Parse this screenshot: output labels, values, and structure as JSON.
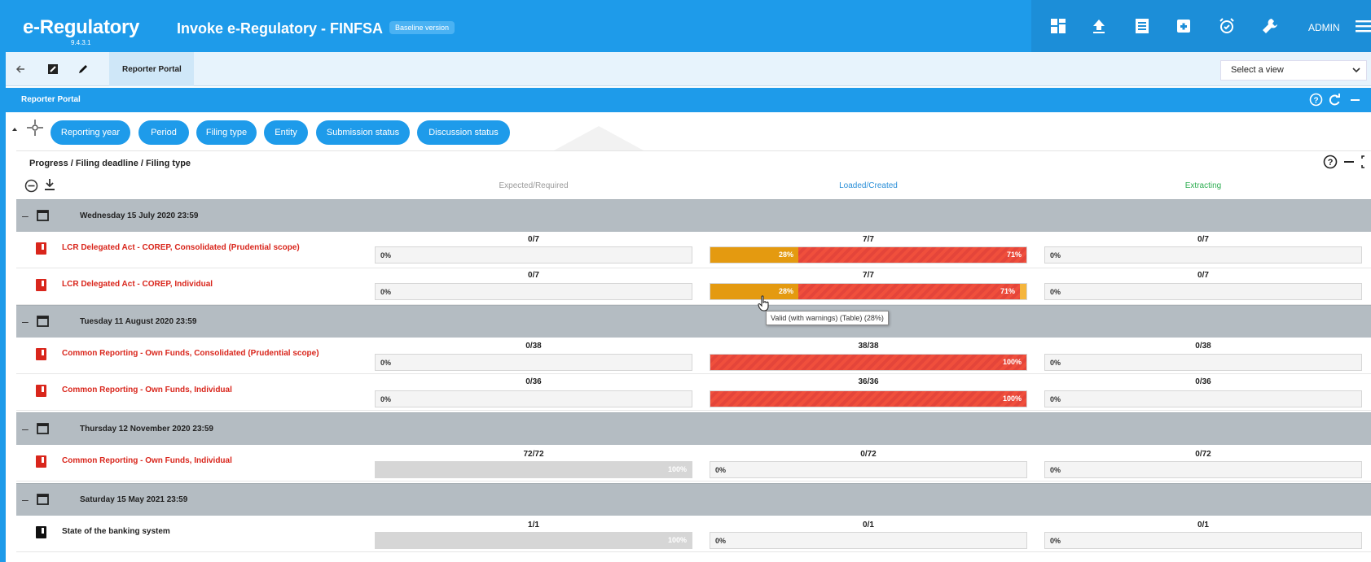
{
  "app": {
    "name": "e-Regulatory",
    "version": "9.4.3.1",
    "title": "Invoke e-Regulatory - FINFSA",
    "badge": "Baseline version",
    "user": "ADMIN",
    "colors": {
      "primary": "#1e9bea",
      "danger": "#d9261c",
      "warning": "#e49a10",
      "valid": "#2eae52"
    }
  },
  "toolbar_icons": [
    "dashboard-icon",
    "upload-icon",
    "list-icon",
    "archive-icon",
    "alarm-icon",
    "wrench-icon",
    "menu-icon"
  ],
  "subbar": {
    "breadcrumb": "Reporter Portal",
    "select_view": "Select a view",
    "icons": [
      "back-arrow-icon",
      "edit-box-icon",
      "pencil-icon"
    ]
  },
  "portal": {
    "title": "Reporter Portal",
    "icons": [
      "help-icon",
      "refresh-icon",
      "minimize-icon"
    ]
  },
  "filters": [
    "Reporting year",
    "Period",
    "Filing type",
    "Entity",
    "Submission status",
    "Discussion status"
  ],
  "panel": {
    "title": "Progress / Filing deadline / Filing type",
    "columns": [
      "Expected/Required",
      "Loaded/Created",
      "Extracting"
    ]
  },
  "groups": [
    {
      "date": "Wednesday 15 July 2020 23:59",
      "items": [
        {
          "name": "LCR Delegated Act - COREP, Consolidated (Prudential scope)",
          "status": "red",
          "expected": {
            "frac": "0/7",
            "zero": "0%"
          },
          "loaded": {
            "frac": "7/7",
            "orange": "28%",
            "red": "71%"
          },
          "extracting": {
            "frac": "0/7",
            "zero": "0%"
          }
        },
        {
          "name": "LCR Delegated Act - COREP, Individual",
          "status": "red",
          "expected": {
            "frac": "0/7",
            "zero": "0%"
          },
          "loaded": {
            "frac": "7/7",
            "orange": "28%",
            "red": "71%"
          },
          "extracting": {
            "frac": "0/7",
            "zero": "0%"
          }
        }
      ]
    },
    {
      "date": "Tuesday 11 August 2020 23:59",
      "items": [
        {
          "name": "Common Reporting - Own Funds, Consolidated (Prudential scope)",
          "status": "red",
          "expected": {
            "frac": "0/38",
            "zero": "0%"
          },
          "loaded": {
            "frac": "38/38",
            "red": "100%"
          },
          "extracting": {
            "frac": "0/38",
            "zero": "0%"
          }
        },
        {
          "name": "Common Reporting - Own Funds, Individual",
          "status": "red",
          "expected": {
            "frac": "0/36",
            "zero": "0%"
          },
          "loaded": {
            "frac": "36/36",
            "red": "100%"
          },
          "extracting": {
            "frac": "0/36",
            "zero": "0%"
          }
        }
      ]
    },
    {
      "date": "Thursday 12 November 2020 23:59",
      "items": [
        {
          "name": "Common Reporting - Own Funds, Individual",
          "status": "red",
          "expected": {
            "frac": "72/72",
            "grey": "100%"
          },
          "loaded": {
            "frac": "0/72",
            "zero": "0%"
          },
          "extracting": {
            "frac": "0/72",
            "zero": "0%"
          }
        }
      ]
    },
    {
      "date": "Saturday 15 May 2021 23:59",
      "items": [
        {
          "name": "State of the banking system",
          "status": "dark",
          "expected": {
            "frac": "1/1",
            "grey": "100%"
          },
          "loaded": {
            "frac": "0/1",
            "zero": "0%"
          },
          "extracting": {
            "frac": "0/1",
            "zero": "0%"
          }
        }
      ]
    }
  ],
  "tooltip": "Valid (with warnings) (Table) (28%)"
}
